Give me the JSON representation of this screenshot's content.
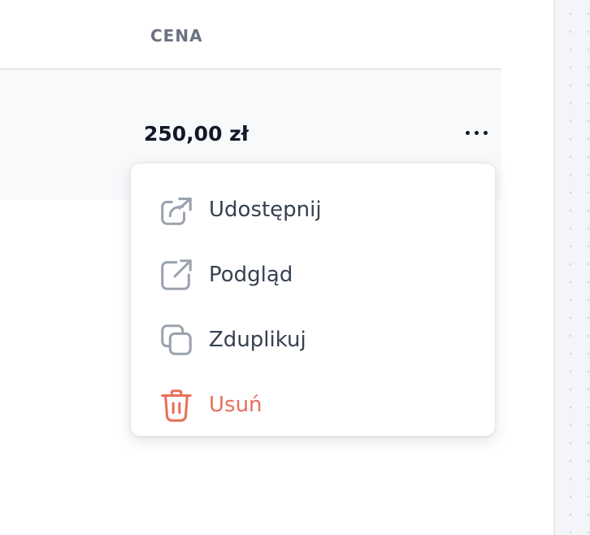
{
  "table": {
    "columns": [
      "CENA"
    ],
    "rows": [
      {
        "price": "250,00 zł"
      }
    ]
  },
  "row_actions": {
    "more_icon": "more-horizontal-icon"
  },
  "menu": {
    "items": [
      {
        "label": "Udostępnij",
        "icon": "share-icon"
      },
      {
        "label": "Podgląd",
        "icon": "external-link-icon"
      },
      {
        "label": "Zduplikuj",
        "icon": "copy-icon"
      },
      {
        "label": "Usuń",
        "icon": "trash-icon",
        "danger": true
      }
    ]
  },
  "colors": {
    "icon_default": "#9ca3af",
    "danger": "#e8705c",
    "text": "#374151",
    "header_text": "#6b7280"
  }
}
